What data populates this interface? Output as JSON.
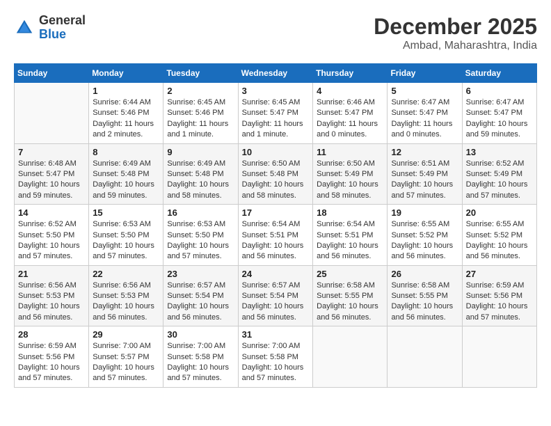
{
  "header": {
    "logo_line1": "General",
    "logo_line2": "Blue",
    "month": "December 2025",
    "location": "Ambad, Maharashtra, India"
  },
  "weekdays": [
    "Sunday",
    "Monday",
    "Tuesday",
    "Wednesday",
    "Thursday",
    "Friday",
    "Saturday"
  ],
  "weeks": [
    [
      {
        "day": "",
        "info": ""
      },
      {
        "day": "1",
        "info": "Sunrise: 6:44 AM\nSunset: 5:46 PM\nDaylight: 11 hours\nand 2 minutes."
      },
      {
        "day": "2",
        "info": "Sunrise: 6:45 AM\nSunset: 5:46 PM\nDaylight: 11 hours\nand 1 minute."
      },
      {
        "day": "3",
        "info": "Sunrise: 6:45 AM\nSunset: 5:47 PM\nDaylight: 11 hours\nand 1 minute."
      },
      {
        "day": "4",
        "info": "Sunrise: 6:46 AM\nSunset: 5:47 PM\nDaylight: 11 hours\nand 0 minutes."
      },
      {
        "day": "5",
        "info": "Sunrise: 6:47 AM\nSunset: 5:47 PM\nDaylight: 11 hours\nand 0 minutes."
      },
      {
        "day": "6",
        "info": "Sunrise: 6:47 AM\nSunset: 5:47 PM\nDaylight: 10 hours\nand 59 minutes."
      }
    ],
    [
      {
        "day": "7",
        "info": "Sunrise: 6:48 AM\nSunset: 5:47 PM\nDaylight: 10 hours\nand 59 minutes."
      },
      {
        "day": "8",
        "info": "Sunrise: 6:49 AM\nSunset: 5:48 PM\nDaylight: 10 hours\nand 59 minutes."
      },
      {
        "day": "9",
        "info": "Sunrise: 6:49 AM\nSunset: 5:48 PM\nDaylight: 10 hours\nand 58 minutes."
      },
      {
        "day": "10",
        "info": "Sunrise: 6:50 AM\nSunset: 5:48 PM\nDaylight: 10 hours\nand 58 minutes."
      },
      {
        "day": "11",
        "info": "Sunrise: 6:50 AM\nSunset: 5:49 PM\nDaylight: 10 hours\nand 58 minutes."
      },
      {
        "day": "12",
        "info": "Sunrise: 6:51 AM\nSunset: 5:49 PM\nDaylight: 10 hours\nand 57 minutes."
      },
      {
        "day": "13",
        "info": "Sunrise: 6:52 AM\nSunset: 5:49 PM\nDaylight: 10 hours\nand 57 minutes."
      }
    ],
    [
      {
        "day": "14",
        "info": "Sunrise: 6:52 AM\nSunset: 5:50 PM\nDaylight: 10 hours\nand 57 minutes."
      },
      {
        "day": "15",
        "info": "Sunrise: 6:53 AM\nSunset: 5:50 PM\nDaylight: 10 hours\nand 57 minutes."
      },
      {
        "day": "16",
        "info": "Sunrise: 6:53 AM\nSunset: 5:50 PM\nDaylight: 10 hours\nand 57 minutes."
      },
      {
        "day": "17",
        "info": "Sunrise: 6:54 AM\nSunset: 5:51 PM\nDaylight: 10 hours\nand 56 minutes."
      },
      {
        "day": "18",
        "info": "Sunrise: 6:54 AM\nSunset: 5:51 PM\nDaylight: 10 hours\nand 56 minutes."
      },
      {
        "day": "19",
        "info": "Sunrise: 6:55 AM\nSunset: 5:52 PM\nDaylight: 10 hours\nand 56 minutes."
      },
      {
        "day": "20",
        "info": "Sunrise: 6:55 AM\nSunset: 5:52 PM\nDaylight: 10 hours\nand 56 minutes."
      }
    ],
    [
      {
        "day": "21",
        "info": "Sunrise: 6:56 AM\nSunset: 5:53 PM\nDaylight: 10 hours\nand 56 minutes."
      },
      {
        "day": "22",
        "info": "Sunrise: 6:56 AM\nSunset: 5:53 PM\nDaylight: 10 hours\nand 56 minutes."
      },
      {
        "day": "23",
        "info": "Sunrise: 6:57 AM\nSunset: 5:54 PM\nDaylight: 10 hours\nand 56 minutes."
      },
      {
        "day": "24",
        "info": "Sunrise: 6:57 AM\nSunset: 5:54 PM\nDaylight: 10 hours\nand 56 minutes."
      },
      {
        "day": "25",
        "info": "Sunrise: 6:58 AM\nSunset: 5:55 PM\nDaylight: 10 hours\nand 56 minutes."
      },
      {
        "day": "26",
        "info": "Sunrise: 6:58 AM\nSunset: 5:55 PM\nDaylight: 10 hours\nand 56 minutes."
      },
      {
        "day": "27",
        "info": "Sunrise: 6:59 AM\nSunset: 5:56 PM\nDaylight: 10 hours\nand 57 minutes."
      }
    ],
    [
      {
        "day": "28",
        "info": "Sunrise: 6:59 AM\nSunset: 5:56 PM\nDaylight: 10 hours\nand 57 minutes."
      },
      {
        "day": "29",
        "info": "Sunrise: 7:00 AM\nSunset: 5:57 PM\nDaylight: 10 hours\nand 57 minutes."
      },
      {
        "day": "30",
        "info": "Sunrise: 7:00 AM\nSunset: 5:58 PM\nDaylight: 10 hours\nand 57 minutes."
      },
      {
        "day": "31",
        "info": "Sunrise: 7:00 AM\nSunset: 5:58 PM\nDaylight: 10 hours\nand 57 minutes."
      },
      {
        "day": "",
        "info": ""
      },
      {
        "day": "",
        "info": ""
      },
      {
        "day": "",
        "info": ""
      }
    ]
  ]
}
